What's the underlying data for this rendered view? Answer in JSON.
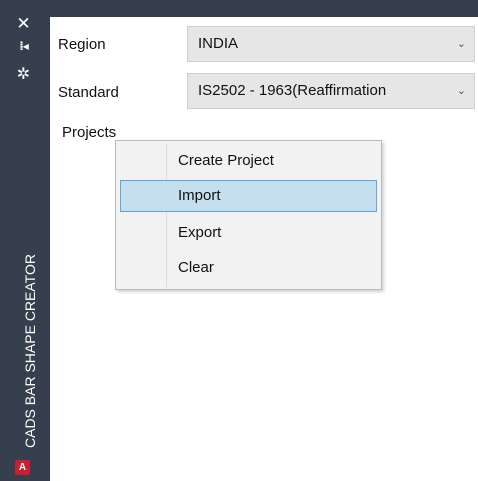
{
  "palette": {
    "title": "CADS BAR SHAPE CREATOR",
    "close_glyph": "✕",
    "pin_glyph": "⁞◂",
    "gear_glyph": "✲",
    "app_icon_letter": "A",
    "colors": {
      "bar": "#353f4d",
      "app_icon": "#c8202f"
    }
  },
  "form": {
    "region": {
      "label": "Region",
      "value": "INDIA"
    },
    "standard": {
      "label": "Standard",
      "value": "IS2502 - 1963(Reaffirmation"
    }
  },
  "projects": {
    "label": "Projects"
  },
  "context_menu": {
    "items": [
      {
        "label": "Create Project",
        "highlighted": false
      },
      {
        "label": "Import",
        "highlighted": true
      },
      {
        "label": "Export",
        "highlighted": false
      },
      {
        "label": "Clear",
        "highlighted": false
      }
    ],
    "colors": {
      "highlight_bg": "#c5dfee",
      "highlight_border": "#5fa6d4"
    }
  },
  "icons": {
    "dropdown": "chevron-down-icon"
  }
}
